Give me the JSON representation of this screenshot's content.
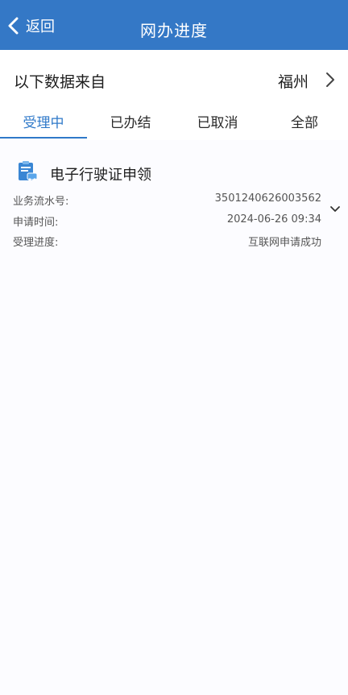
{
  "nav": {
    "back_label": "返回",
    "title": "网办进度"
  },
  "source": {
    "label": "以下数据来自",
    "city": "福州"
  },
  "tabs": [
    {
      "label": "受理中",
      "active": true
    },
    {
      "label": "已办结",
      "active": false
    },
    {
      "label": "已取消",
      "active": false
    },
    {
      "label": "全部",
      "active": false
    }
  ],
  "card": {
    "title": "电子行驶证申领",
    "icon": "vehicle-license-icon",
    "details": [
      {
        "label": "业务流水号:",
        "value": "3501240626003562"
      },
      {
        "label": "申请时间:",
        "value": "2024-06-26 09:34"
      },
      {
        "label": "受理进度:",
        "value": "互联网申请成功"
      }
    ]
  },
  "colors": {
    "nav_bg": "#3478c6",
    "accent": "#2f79c9"
  }
}
